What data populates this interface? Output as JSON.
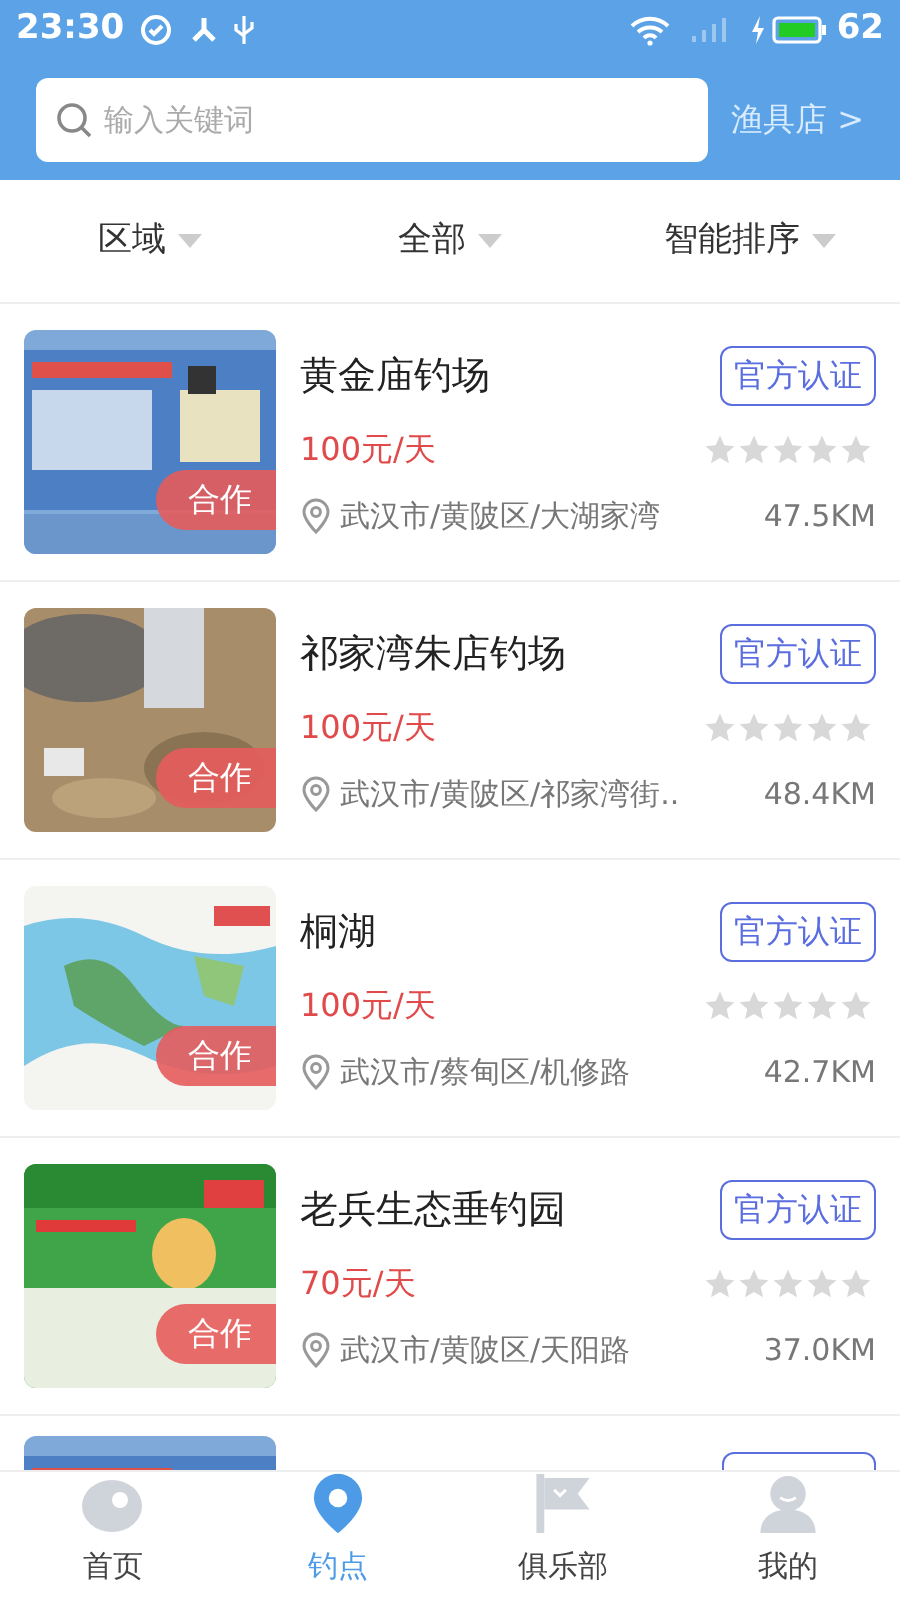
{
  "status_bar": {
    "time": "23:30",
    "battery": "62"
  },
  "search": {
    "placeholder": "输入关键词",
    "link": "渔具店 >"
  },
  "filters": [
    {
      "label": "区域"
    },
    {
      "label": "全部"
    },
    {
      "label": "智能排序"
    }
  ],
  "spots": [
    {
      "kind": "full",
      "name": "黄金庙钓场",
      "price": "100元/天",
      "badge": "官方认证",
      "tag": "合作",
      "stars": 0,
      "location": "武汉市/黄陂区/大湖家湾",
      "distance": "47.5KM"
    },
    {
      "kind": "full",
      "name": "祁家湾朱店钓场",
      "price": "100元/天",
      "badge": "官方认证",
      "tag": "合作",
      "stars": 0,
      "location": "武汉市/黄陂区/祁家湾街..",
      "distance": "48.4KM"
    },
    {
      "kind": "full",
      "name": "桐湖",
      "price": "100元/天",
      "badge": "官方认证",
      "tag": "合作",
      "stars": 0,
      "location": "武汉市/蔡甸区/机修路",
      "distance": "42.7KM"
    },
    {
      "kind": "full",
      "name": "老兵生态垂钓园",
      "price": "70元/天",
      "badge": "官方认证",
      "tag": "合作",
      "stars": 0,
      "location": "武汉市/黄陂区/天阳路",
      "distance": "37.0KM"
    },
    {
      "kind": "partial"
    }
  ],
  "nav": [
    {
      "label": "首页",
      "selected": false
    },
    {
      "label": "钓点",
      "selected": true
    },
    {
      "label": "俱乐部",
      "selected": false
    },
    {
      "label": "我的",
      "selected": false
    }
  ]
}
